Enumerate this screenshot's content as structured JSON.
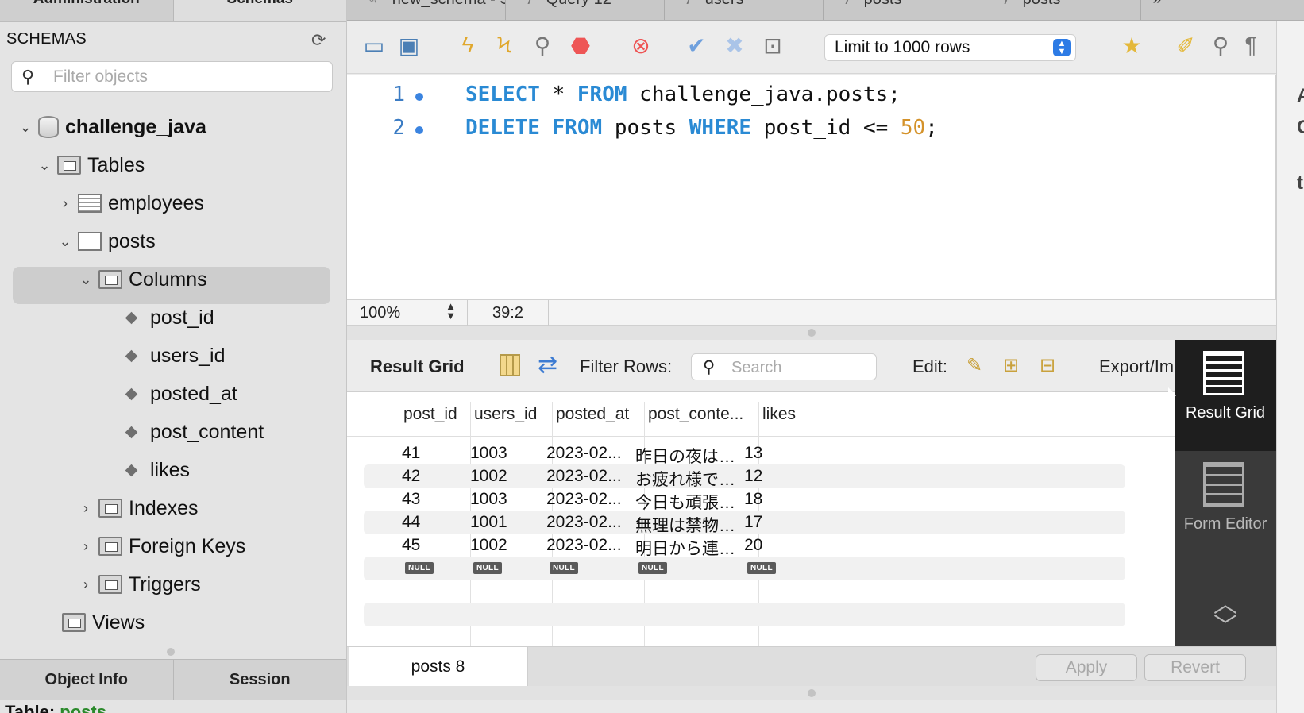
{
  "left_panel": {
    "tabs": [
      "Administration",
      "Schemas"
    ],
    "header": "SCHEMAS",
    "filter_placeholder": "Filter objects",
    "tree": {
      "schema": "challenge_java",
      "tables_label": "Tables",
      "tables": [
        "employees",
        "posts"
      ],
      "columns_label": "Columns",
      "columns": [
        "post_id",
        "users_id",
        "posted_at",
        "post_content",
        "likes"
      ],
      "indexes_label": "Indexes",
      "foreign_keys_label": "Foreign Keys",
      "triggers_label": "Triggers",
      "views_label": "Views"
    },
    "bottom_tabs": [
      "Object Info",
      "Session"
    ],
    "table_info_label": "Table:",
    "table_info_name": "posts"
  },
  "top_tabs": [
    "new_schema - Schema",
    "Query 12",
    "users",
    "posts",
    "posts"
  ],
  "toolbar": {
    "limit_label": "Limit to 1000 rows"
  },
  "editor": {
    "lines": [
      {
        "num": "1",
        "parts": [
          [
            "kw",
            "SELECT"
          ],
          [
            "t",
            " * "
          ],
          [
            "kw",
            "FROM"
          ],
          [
            "t",
            " challenge_java.posts;"
          ]
        ]
      },
      {
        "num": "2",
        "parts": [
          [
            "kw",
            "DELETE"
          ],
          [
            "t",
            " "
          ],
          [
            "kw",
            "FROM"
          ],
          [
            "t",
            " posts "
          ],
          [
            "kw",
            "WHERE"
          ],
          [
            "t",
            " post_id <= "
          ],
          [
            "num",
            "50"
          ],
          [
            "t",
            ";"
          ]
        ]
      }
    ],
    "zoom": "100%",
    "cursor": "39:2"
  },
  "result_toolbar": {
    "label": "Result Grid",
    "filter_label": "Filter Rows:",
    "search_placeholder": "Search",
    "edit_label": "Edit:",
    "export_label": "Export/Im"
  },
  "grid": {
    "headers": [
      "post_id",
      "users_id",
      "posted_at",
      "post_conte...",
      "likes"
    ],
    "rows": [
      [
        "41",
        "1003",
        "2023-02...",
        "昨日の夜は…",
        "13"
      ],
      [
        "42",
        "1002",
        "2023-02...",
        "お疲れ様で…",
        "12"
      ],
      [
        "43",
        "1003",
        "2023-02...",
        "今日も頑張…",
        "18"
      ],
      [
        "44",
        "1001",
        "2023-02...",
        "無理は禁物…",
        "17"
      ],
      [
        "45",
        "1002",
        "2023-02...",
        "明日から連…",
        "20"
      ]
    ],
    "null_label": "NULL"
  },
  "side_panel": {
    "result_grid": "Result Grid",
    "form_editor": "Form Editor"
  },
  "bottom_bar": {
    "tab": "posts 8",
    "apply": "Apply",
    "revert": "Revert"
  }
}
